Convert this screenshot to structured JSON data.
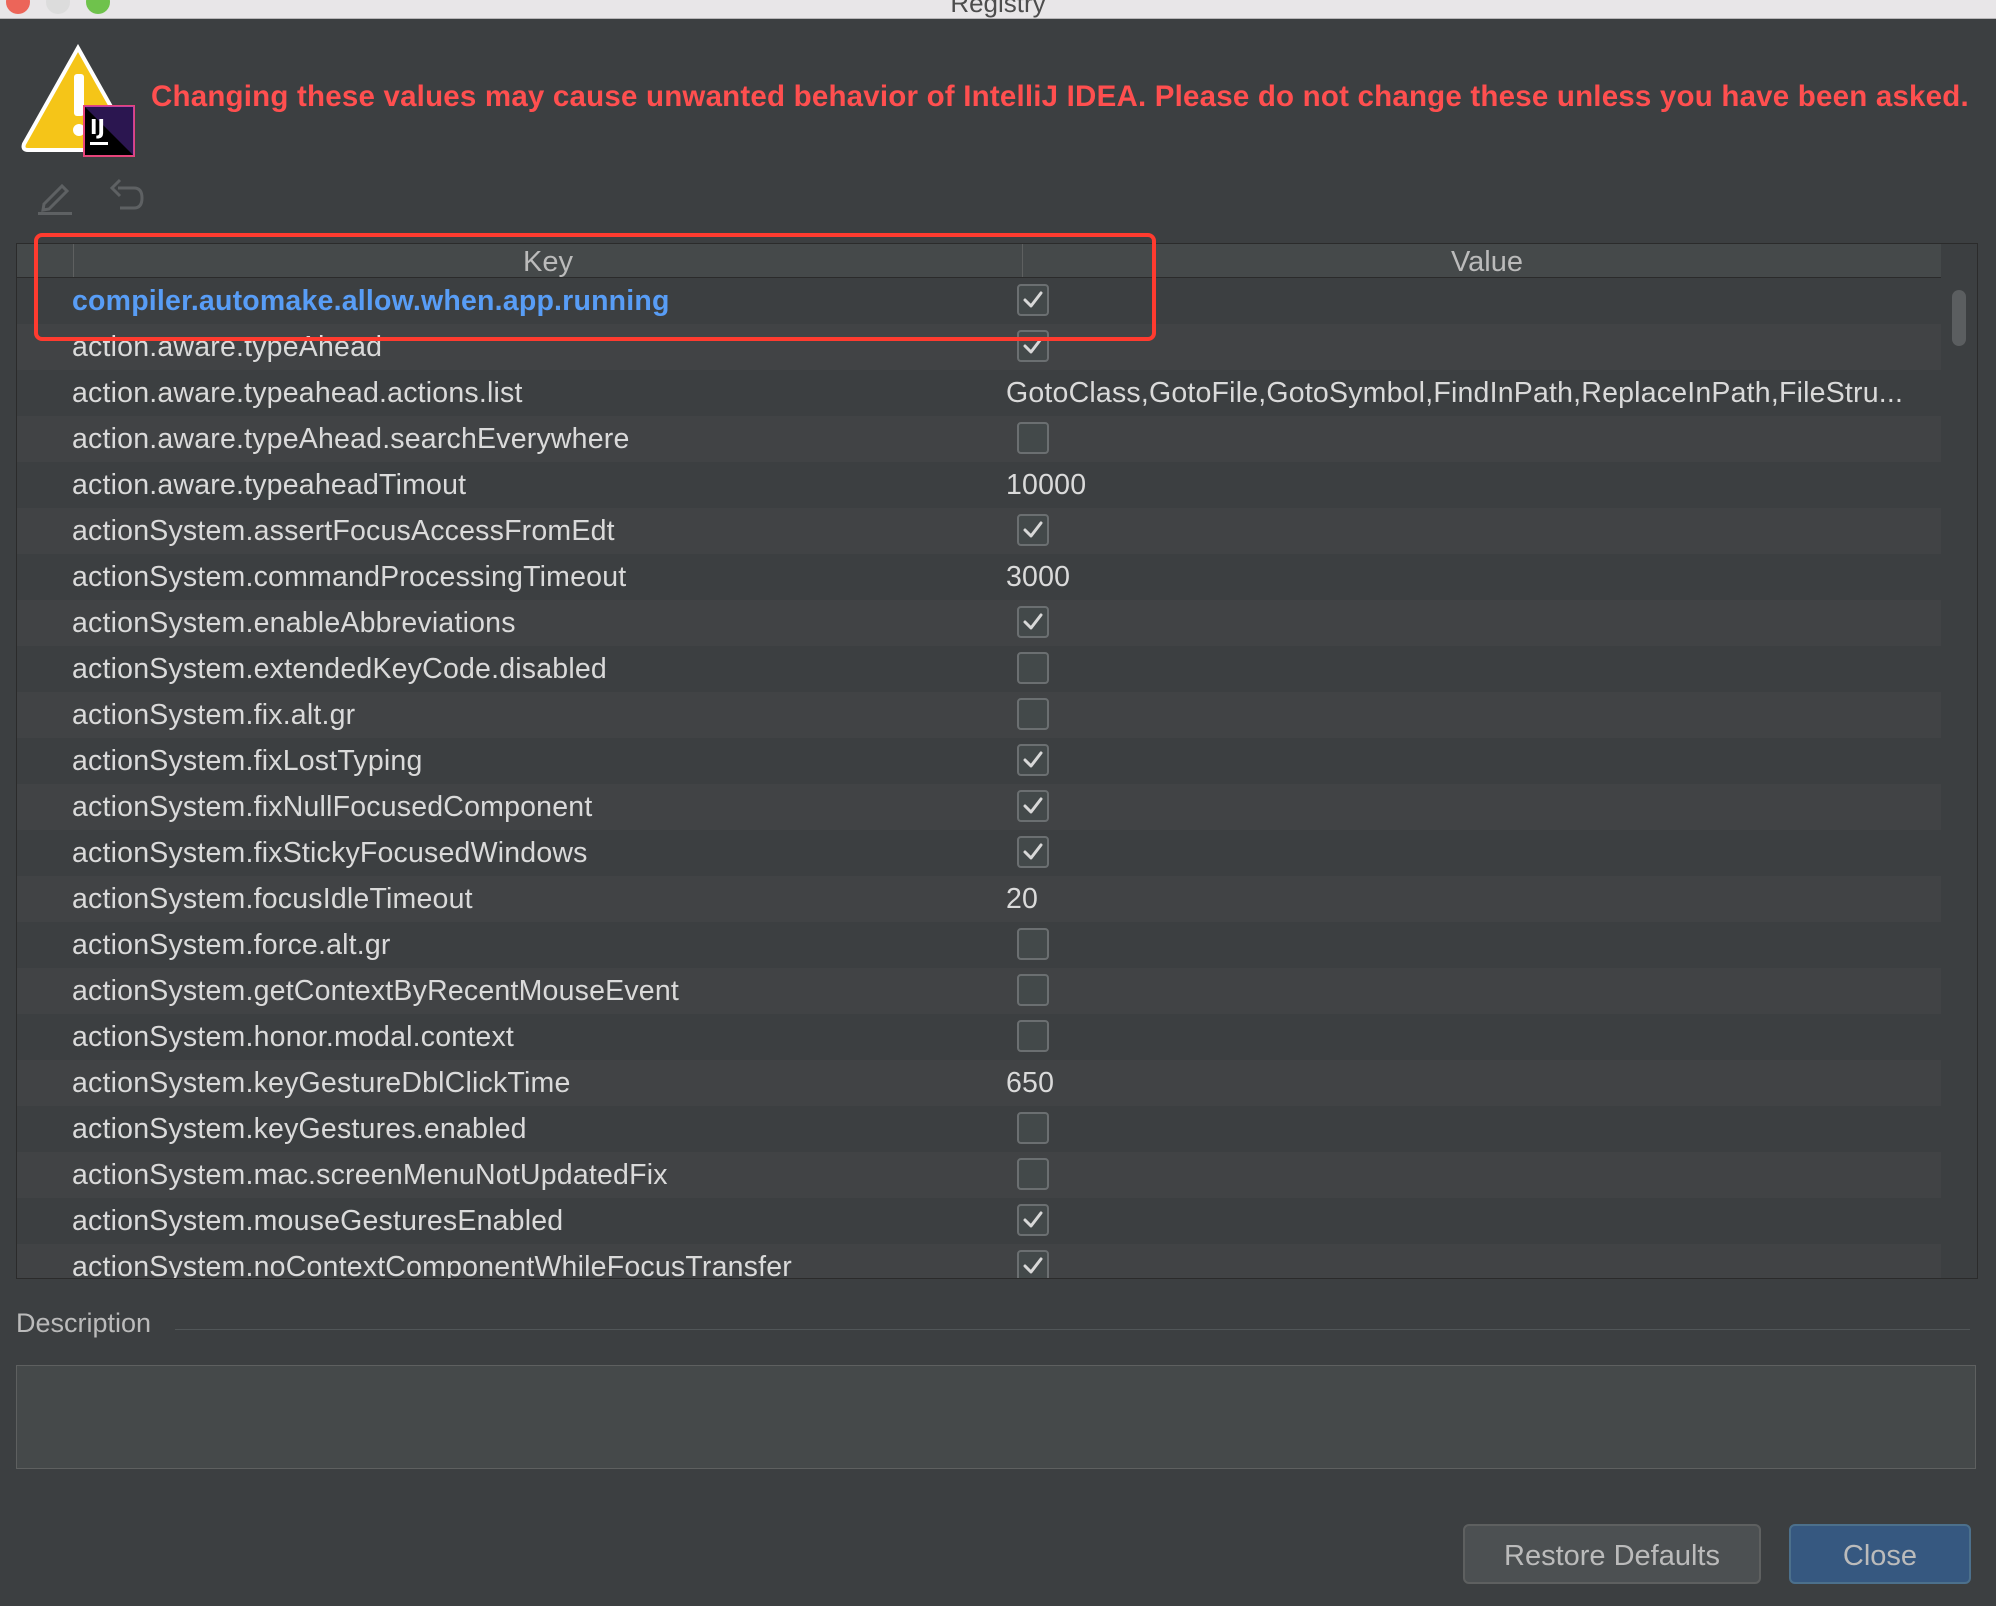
{
  "window": {
    "title": "Registry"
  },
  "warning": {
    "text": "Changing these values may cause unwanted behavior of IntelliJ IDEA. Please do not change these unless you have been asked."
  },
  "icons": {
    "warning": "warning-triangle-intellij-icon",
    "edit": "pencil-edit-icon",
    "revert": "undo-revert-icon"
  },
  "table": {
    "columns": [
      "Key",
      "Value"
    ],
    "rows": [
      {
        "key": "compiler.automake.allow.when.app.running",
        "type": "bool",
        "checked": true,
        "highlighted": true
      },
      {
        "key": "action.aware.typeAhead",
        "type": "bool",
        "checked": true
      },
      {
        "key": "action.aware.typeahead.actions.list",
        "type": "text",
        "value": "GotoClass,GotoFile,GotoSymbol,FindInPath,ReplaceInPath,FileStru..."
      },
      {
        "key": "action.aware.typeAhead.searchEverywhere",
        "type": "bool",
        "checked": false
      },
      {
        "key": "action.aware.typeaheadTimout",
        "type": "text",
        "value": "10000"
      },
      {
        "key": "actionSystem.assertFocusAccessFromEdt",
        "type": "bool",
        "checked": true
      },
      {
        "key": "actionSystem.commandProcessingTimeout",
        "type": "text",
        "value": "3000"
      },
      {
        "key": "actionSystem.enableAbbreviations",
        "type": "bool",
        "checked": true
      },
      {
        "key": "actionSystem.extendedKeyCode.disabled",
        "type": "bool",
        "checked": false
      },
      {
        "key": "actionSystem.fix.alt.gr",
        "type": "bool",
        "checked": false
      },
      {
        "key": "actionSystem.fixLostTyping",
        "type": "bool",
        "checked": true
      },
      {
        "key": "actionSystem.fixNullFocusedComponent",
        "type": "bool",
        "checked": true
      },
      {
        "key": "actionSystem.fixStickyFocusedWindows",
        "type": "bool",
        "checked": true
      },
      {
        "key": "actionSystem.focusIdleTimeout",
        "type": "text",
        "value": "20"
      },
      {
        "key": "actionSystem.force.alt.gr",
        "type": "bool",
        "checked": false
      },
      {
        "key": "actionSystem.getContextByRecentMouseEvent",
        "type": "bool",
        "checked": false
      },
      {
        "key": "actionSystem.honor.modal.context",
        "type": "bool",
        "checked": false
      },
      {
        "key": "actionSystem.keyGestureDblClickTime",
        "type": "text",
        "value": "650"
      },
      {
        "key": "actionSystem.keyGestures.enabled",
        "type": "bool",
        "checked": false
      },
      {
        "key": "actionSystem.mac.screenMenuNotUpdatedFix",
        "type": "bool",
        "checked": false
      },
      {
        "key": "actionSystem.mouseGesturesEnabled",
        "type": "bool",
        "checked": true
      },
      {
        "key": "actionSystem.noContextComponentWhileFocusTransfer",
        "type": "bool",
        "checked": true
      }
    ]
  },
  "description": {
    "label": "Description",
    "text": ""
  },
  "buttons": {
    "restore": "Restore Defaults",
    "close": "Close"
  },
  "colors": {
    "background": "#3c3f41",
    "warning": "#ff4f4f",
    "selected_key": "#589df6",
    "annotation": "#ff3b2f",
    "primary_button": "#365880"
  }
}
